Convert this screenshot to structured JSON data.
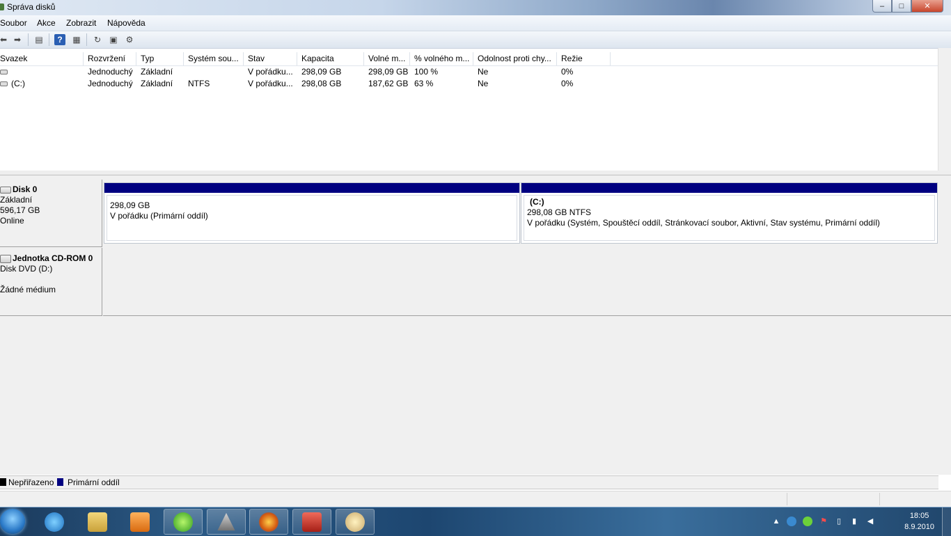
{
  "window": {
    "title": "Správa disků"
  },
  "window_buttons": {
    "minimize": "–",
    "maximize": "□",
    "close": "✕"
  },
  "menu": [
    "Soubor",
    "Akce",
    "Zobrazit",
    "Nápověda"
  ],
  "table": {
    "columns": [
      "Svazek",
      "Rozvržení",
      "Typ",
      "Systém sou...",
      "Stav",
      "Kapacita",
      "Volné m...",
      "% volného m...",
      "Odolnost proti chy...",
      "Režie"
    ],
    "rows": [
      [
        "",
        "Jednoduchý",
        "Základní",
        "",
        "V pořádku...",
        "298,09 GB",
        "298,09 GB",
        "100 %",
        "Ne",
        "0%"
      ],
      [
        "(C:)",
        "Jednoduchý",
        "Základní",
        "NTFS",
        "V pořádku...",
        "298,08 GB",
        "187,62 GB",
        "63 %",
        "Ne",
        "0%"
      ]
    ]
  },
  "disks": {
    "disk0": {
      "name": "Disk 0",
      "type": "Základní",
      "size": "596,17 GB",
      "status": "Online",
      "partitions": [
        {
          "label": "",
          "size": "298,09 GB",
          "status": "V pořádku (Primární oddíl)"
        },
        {
          "label": "(C:)",
          "size": "298,08 GB NTFS",
          "status": "V pořádku (Systém, Spouštěcí oddíl, Stránkovací soubor, Aktivní, Stav systému, Primární oddíl)"
        }
      ]
    },
    "cdrom0": {
      "name": "Jednotka CD-ROM 0",
      "type": "Disk DVD (D:)",
      "status": "Žádné médium"
    }
  },
  "legend": [
    {
      "label": "Nepřiřazeno",
      "color": "#000000"
    },
    {
      "label": "Primární oddíl",
      "color": "#000080"
    }
  ],
  "taskbar": {
    "apps": [
      "internet-explorer-icon",
      "file-explorer-icon",
      "media-player-icon",
      "icq-icon",
      "app-triangle-icon",
      "firefox-icon",
      "toolbox-icon",
      "paint-icon"
    ],
    "clock_time": "18:05",
    "clock_date": "8.9.2010"
  },
  "colors": {
    "primary_partition": "#000080",
    "unallocated": "#000000"
  }
}
